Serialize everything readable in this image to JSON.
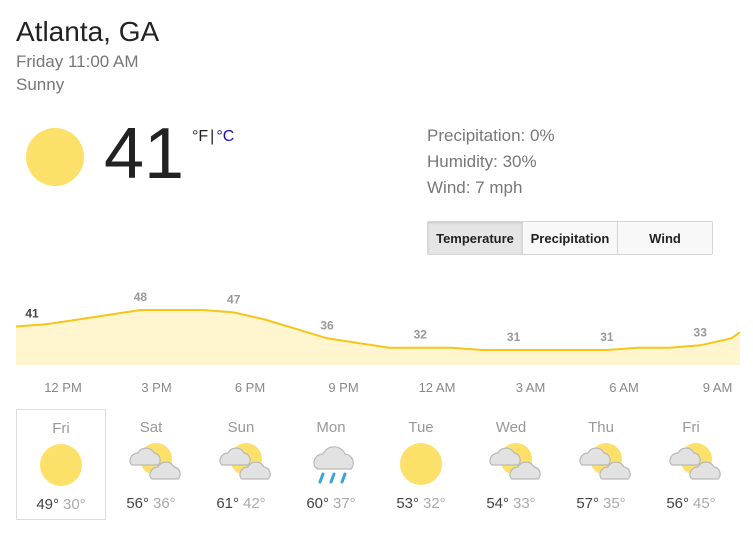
{
  "header": {
    "location": "Atlanta, GA",
    "datetime": "Friday 11:00 AM",
    "condition": "Sunny"
  },
  "current": {
    "temperature": "41",
    "unit_f": "°F",
    "unit_sep": "|",
    "unit_c": "°C",
    "icon": "sun-icon"
  },
  "stats": {
    "precipitation": "Precipitation: 0%",
    "humidity": "Humidity: 30%",
    "wind": "Wind: 7 mph"
  },
  "tabs": [
    {
      "label": "Temperature",
      "active": true
    },
    {
      "label": "Precipitation",
      "active": false
    },
    {
      "label": "Wind",
      "active": false
    }
  ],
  "chart_data": {
    "type": "area",
    "x": [
      "11 AM",
      "12 PM",
      "1 PM",
      "2 PM",
      "3 PM",
      "4 PM",
      "5 PM",
      "6 PM",
      "7 PM",
      "8 PM",
      "9 PM",
      "10 PM",
      "11 PM",
      "12 AM",
      "1 AM",
      "2 AM",
      "3 AM",
      "4 AM",
      "5 AM",
      "6 AM",
      "7 AM",
      "8 AM",
      "9 AM",
      "10 AM"
    ],
    "values": [
      41,
      42,
      44,
      46,
      48,
      48,
      48,
      47,
      44,
      40,
      36,
      34,
      32,
      32,
      32,
      31,
      31,
      31,
      31,
      31,
      32,
      32,
      33,
      36
    ],
    "point_labels": [
      {
        "index": 0,
        "text": "41"
      },
      {
        "index": 4,
        "text": "48"
      },
      {
        "index": 7,
        "text": "47"
      },
      {
        "index": 10,
        "text": "36"
      },
      {
        "index": 13,
        "text": "32"
      },
      {
        "index": 16,
        "text": "31"
      },
      {
        "index": 19,
        "text": "31"
      },
      {
        "index": 22,
        "text": "33"
      }
    ],
    "x_tick_labels": [
      "12 PM",
      "3 PM",
      "6 PM",
      "9 PM",
      "12 AM",
      "3 AM",
      "6 AM",
      "9 AM"
    ],
    "line_color": "#f5c518",
    "fill_color": "#fff6d0"
  },
  "forecast": [
    {
      "day": "Fri",
      "icon": "sun-icon",
      "hi": "49°",
      "lo": "30°",
      "selected": true
    },
    {
      "day": "Sat",
      "icon": "partly-cloudy-icon",
      "hi": "56°",
      "lo": "36°"
    },
    {
      "day": "Sun",
      "icon": "partly-cloudy-icon",
      "hi": "61°",
      "lo": "42°"
    },
    {
      "day": "Mon",
      "icon": "rain-icon",
      "hi": "60°",
      "lo": "37°"
    },
    {
      "day": "Tue",
      "icon": "sun-icon",
      "hi": "53°",
      "lo": "32°"
    },
    {
      "day": "Wed",
      "icon": "partly-cloudy-icon",
      "hi": "54°",
      "lo": "33°"
    },
    {
      "day": "Thu",
      "icon": "partly-cloudy-icon",
      "hi": "57°",
      "lo": "35°"
    },
    {
      "day": "Fri",
      "icon": "partly-cloudy-icon",
      "hi": "56°",
      "lo": "45°"
    }
  ],
  "colors": {
    "sun": "#fde06a",
    "cloud": "#e2e2e2",
    "cloud_stroke": "#b9b9b9",
    "rain": "#3aa3d8",
    "link": "#1a0dab"
  }
}
